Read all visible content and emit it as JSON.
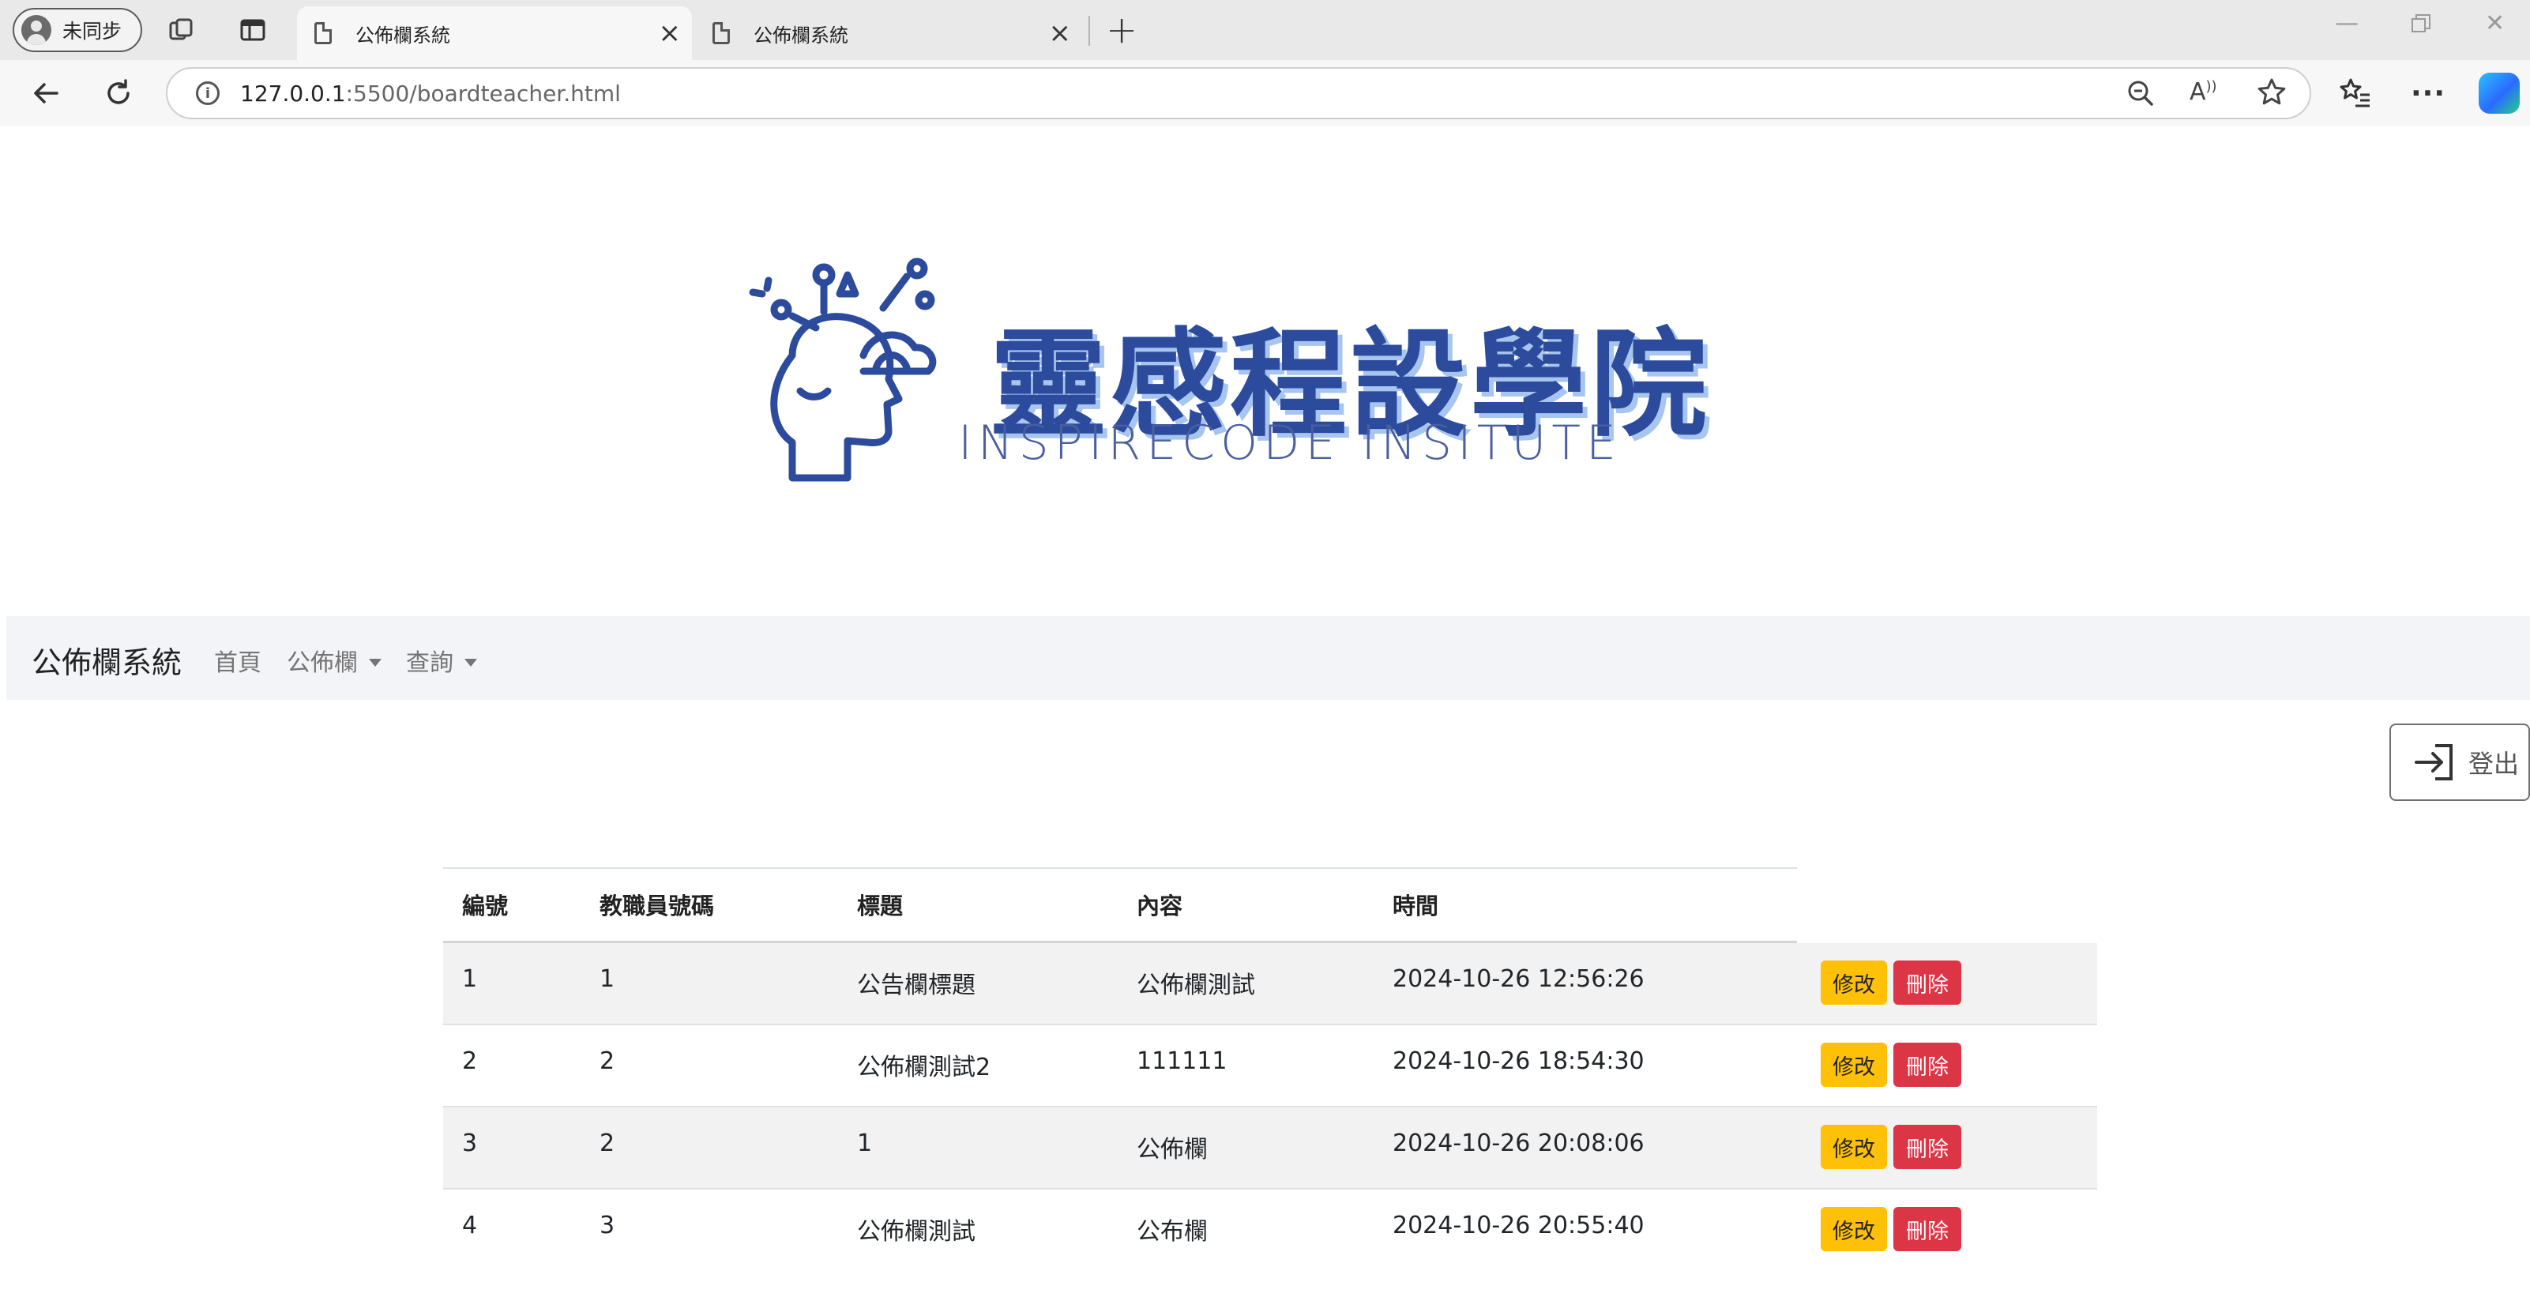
{
  "browser": {
    "profile_label": "未同步",
    "tabs": [
      {
        "title": "公佈欄系統",
        "active": true
      },
      {
        "title": "公佈欄系統",
        "active": false
      }
    ],
    "url_host": "127.0.0.1",
    "url_path": ":5500/boardteacher.html"
  },
  "logo": {
    "title": "靈感程設學院",
    "subtitle": "INSPIRECODE INSITUTE"
  },
  "navbar": {
    "brand": "公佈欄系統",
    "links": [
      {
        "label": "首頁",
        "dropdown": false
      },
      {
        "label": "公佈欄",
        "dropdown": true
      },
      {
        "label": "查詢",
        "dropdown": true
      }
    ]
  },
  "logout_label": "登出",
  "table": {
    "headers": [
      "編號",
      "教職員號碼",
      "標題",
      "內容",
      "時間"
    ],
    "rows": [
      {
        "id": "1",
        "staff": "1",
        "title": "公告欄標題",
        "content": "公佈欄測試",
        "time": "2024-10-26 12:56:26"
      },
      {
        "id": "2",
        "staff": "2",
        "title": "公佈欄測試2",
        "content": "111111",
        "time": "2024-10-26 18:54:30"
      },
      {
        "id": "3",
        "staff": "2",
        "title": "1",
        "content": "公佈欄",
        "time": "2024-10-26 20:08:06"
      },
      {
        "id": "4",
        "staff": "3",
        "title": "公佈欄測試",
        "content": "公布欄",
        "time": "2024-10-26 20:55:40"
      }
    ],
    "edit_label": "修改",
    "delete_label": "刪除"
  },
  "colors": {
    "edit_button": "#ffc107",
    "delete_button": "#dc3545",
    "navbar_bg": "#f3f4f8",
    "logo_blue": "#2c4b9c"
  }
}
